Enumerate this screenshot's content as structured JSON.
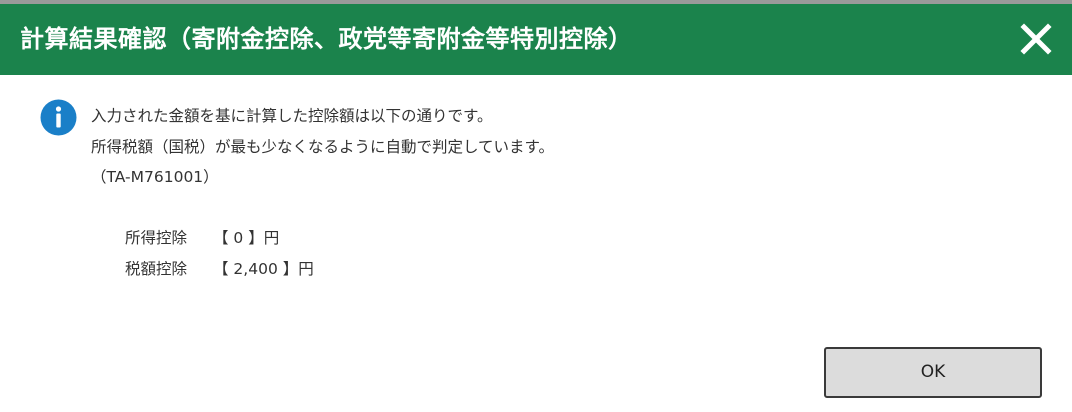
{
  "dialog": {
    "title": "計算結果確認（寄附金控除、政党等寄附金等特別控除）",
    "close_icon": "close-icon",
    "info_icon": "info-icon",
    "colors": {
      "title_bar": "#1b834c",
      "title_text": "#ffffff",
      "info_icon": "#1a7fc8",
      "button_bg": "#dcdcdc"
    }
  },
  "message": {
    "line1": "入力された金額を基に計算した控除額は以下の通りです。",
    "line2": "所得税額（国税）が最も少なくなるように自動で判定しています。",
    "line3": "（TA-M761001）"
  },
  "results": [
    {
      "label": "所得控除",
      "value": "【 0 】円"
    },
    {
      "label": "税額控除",
      "value": "【 2,400 】円"
    }
  ],
  "buttons": {
    "ok_label": "OK"
  }
}
